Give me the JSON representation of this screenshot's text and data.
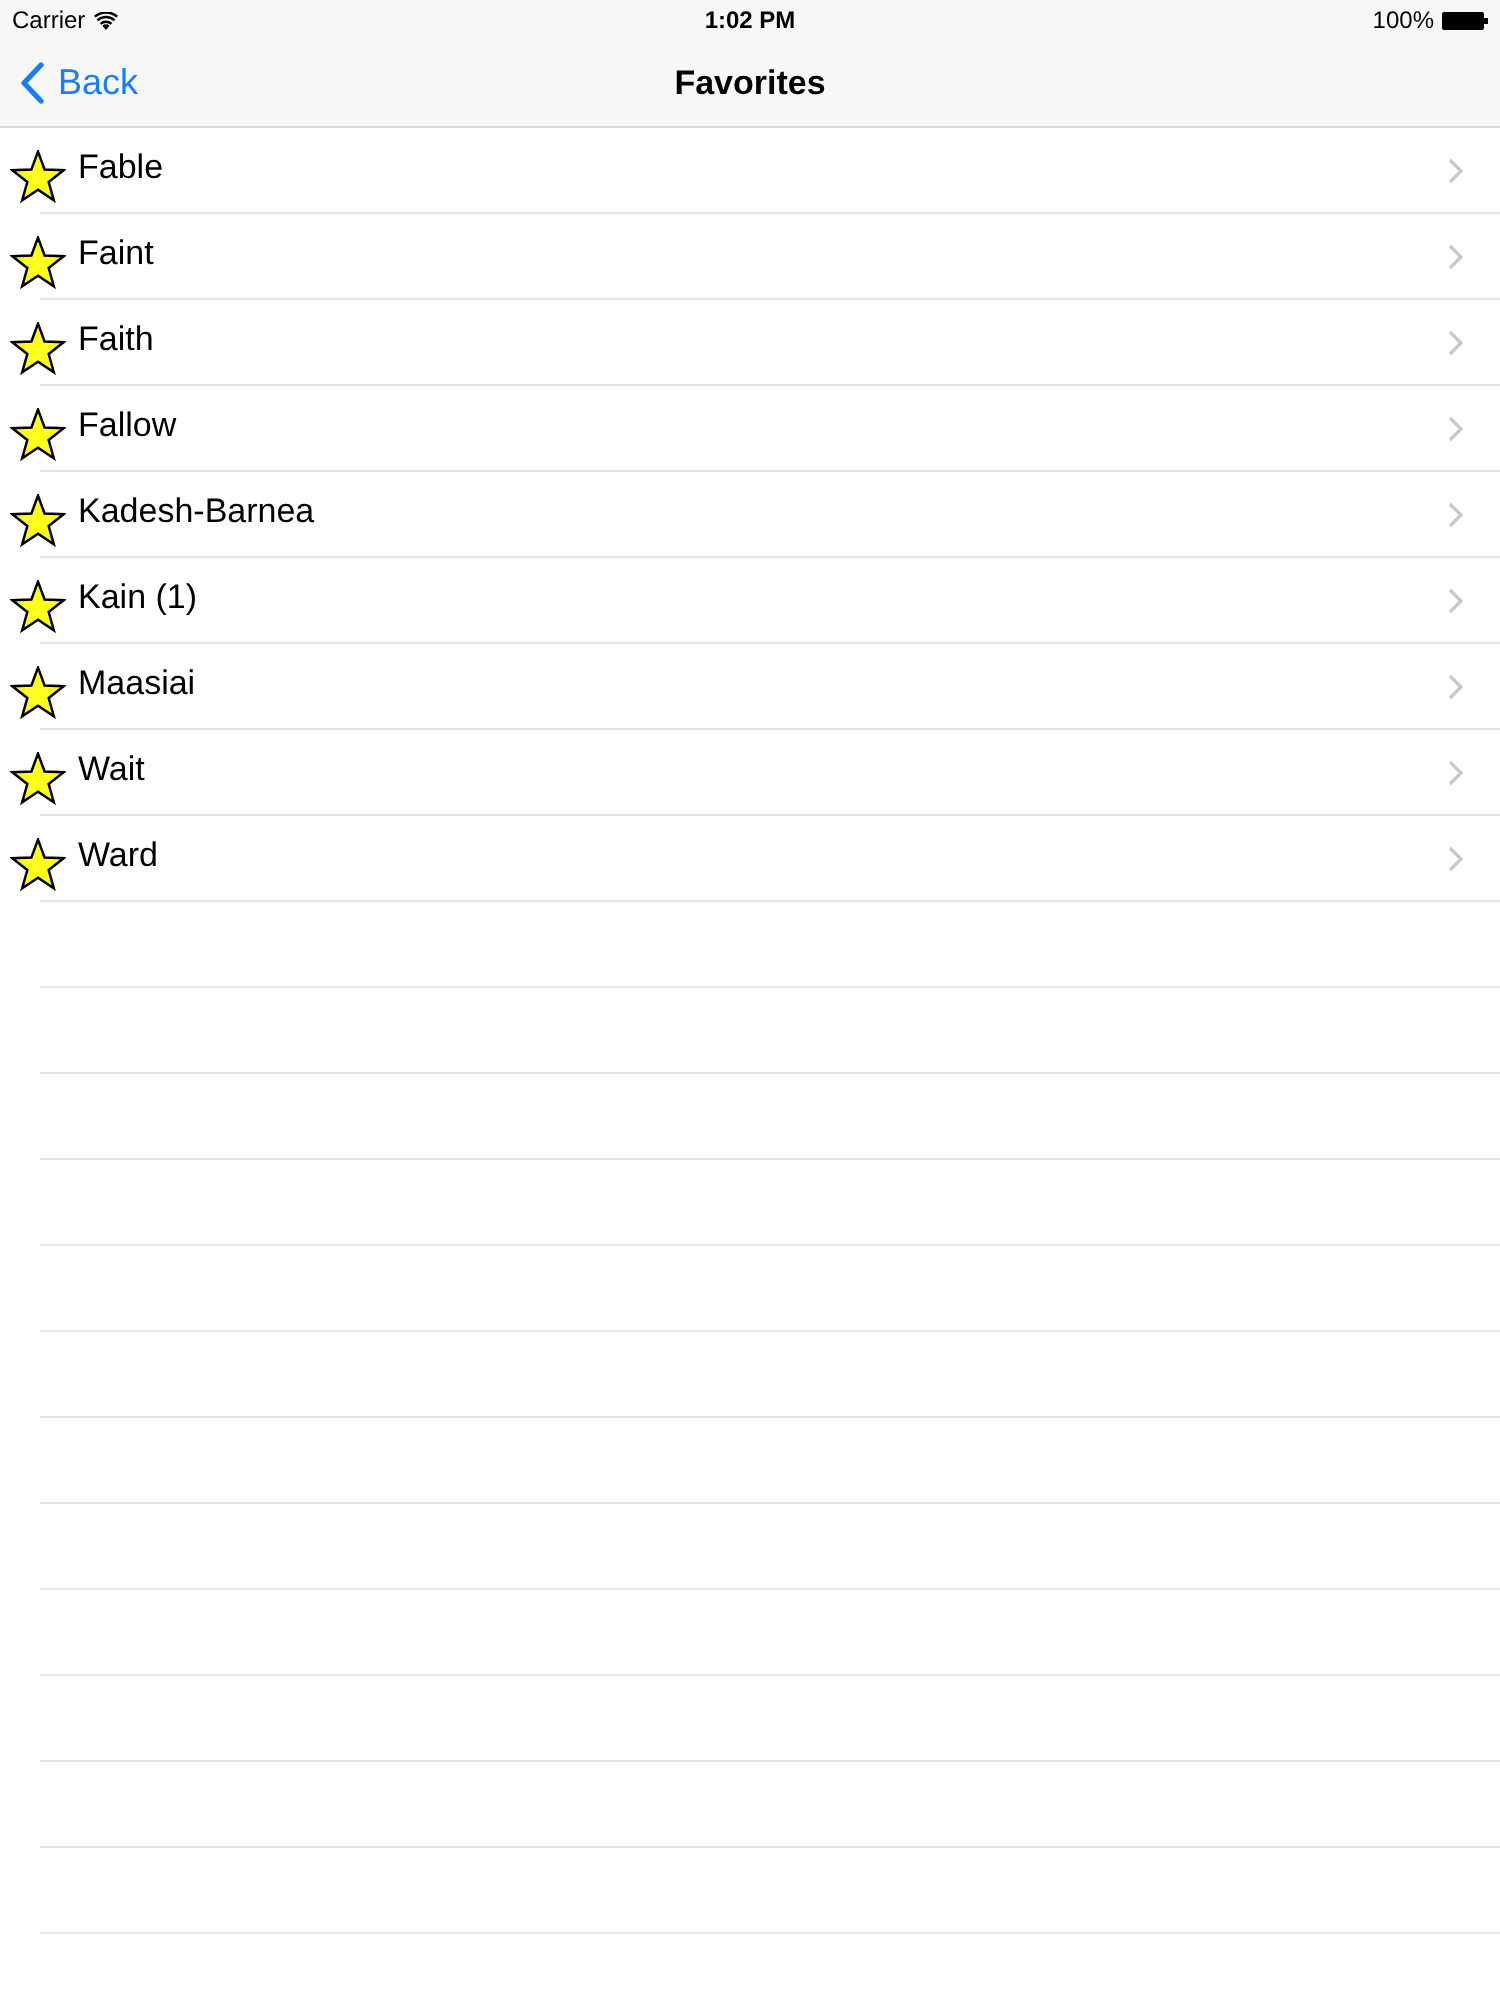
{
  "status_bar": {
    "carrier": "Carrier",
    "time": "1:02 PM",
    "battery": "100%"
  },
  "nav_bar": {
    "back": "Back",
    "title": "Favorites"
  },
  "favorites": [
    {
      "label": "Fable"
    },
    {
      "label": "Faint"
    },
    {
      "label": "Faith"
    },
    {
      "label": "Fallow"
    },
    {
      "label": "Kadesh-Barnea"
    },
    {
      "label": "Kain (1)"
    },
    {
      "label": "Maasiai"
    },
    {
      "label": "Wait"
    },
    {
      "label": "Ward"
    }
  ]
}
